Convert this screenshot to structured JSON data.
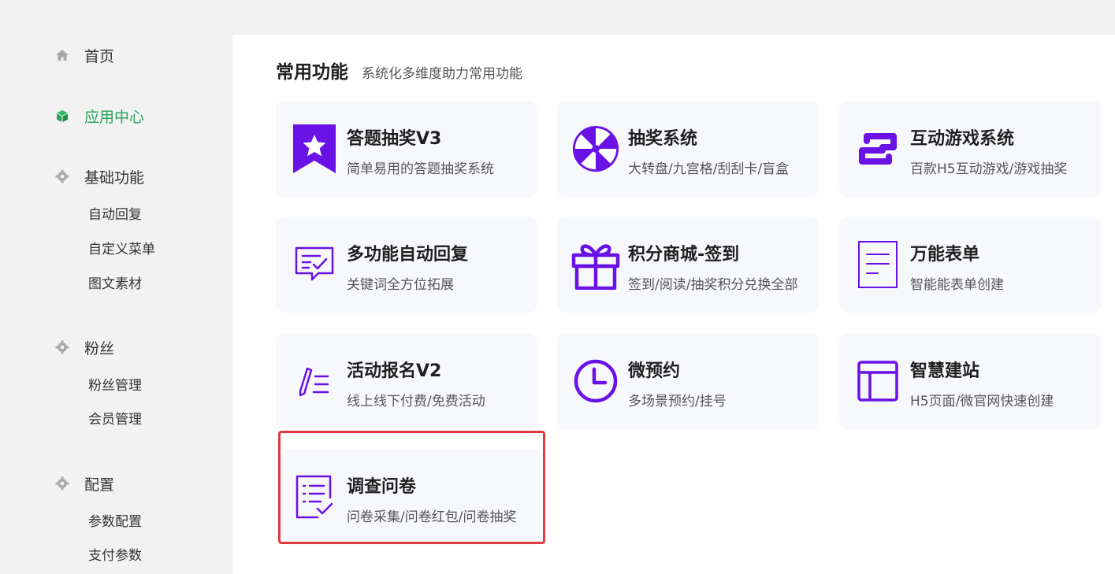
{
  "sidebar": {
    "home": {
      "label": "首页",
      "icon": "home-icon"
    },
    "app_center": {
      "label": "应用中心",
      "icon": "cube-icon"
    },
    "basic": {
      "label": "基础功能",
      "icon": "gear-icon",
      "items": [
        "自动回复",
        "自定义菜单",
        "图文素材"
      ]
    },
    "fans": {
      "label": "粉丝",
      "icon": "gear-icon",
      "items": [
        "粉丝管理",
        "会员管理"
      ]
    },
    "config": {
      "label": "配置",
      "icon": "gear-icon",
      "items": [
        "参数配置",
        "支付参数"
      ]
    }
  },
  "section": {
    "title": "常用功能",
    "subtitle": "系统化多维度助力常用功能"
  },
  "cards": [
    {
      "name": "答题抽奖V3",
      "desc": "简单易用的答题抽奖系统",
      "icon": "star-ribbon-icon"
    },
    {
      "name": "抽奖系统",
      "desc": "大转盘/九宫格/刮刮卡/盲盒",
      "icon": "wheel-icon"
    },
    {
      "name": "互动游戏系统",
      "desc": "百款H5互动游戏/游戏抽奖",
      "icon": "link-icon"
    },
    {
      "name": "多功能自动回复",
      "desc": "关键词全方位拓展",
      "icon": "chat-check-icon"
    },
    {
      "name": "积分商城-签到",
      "desc": "签到/阅读/抽奖积分兑换全部",
      "icon": "gift-icon"
    },
    {
      "name": "万能表单",
      "desc": "智能能表单创建",
      "icon": "form-icon"
    },
    {
      "name": "活动报名V2",
      "desc": "线上线下付费/免费活动",
      "icon": "pen-list-icon"
    },
    {
      "name": "微预约",
      "desc": "多场景预约/挂号",
      "icon": "clock-icon"
    },
    {
      "name": "智慧建站",
      "desc": "H5页面/微官网快速创建",
      "icon": "layout-icon"
    },
    {
      "name": "调查问卷",
      "desc": "问卷采集/问卷红包/问卷抽奖",
      "icon": "survey-icon"
    }
  ],
  "colors": {
    "accent": "#6a11e6",
    "active_nav": "#27a35a",
    "highlight": "#e0393e"
  }
}
